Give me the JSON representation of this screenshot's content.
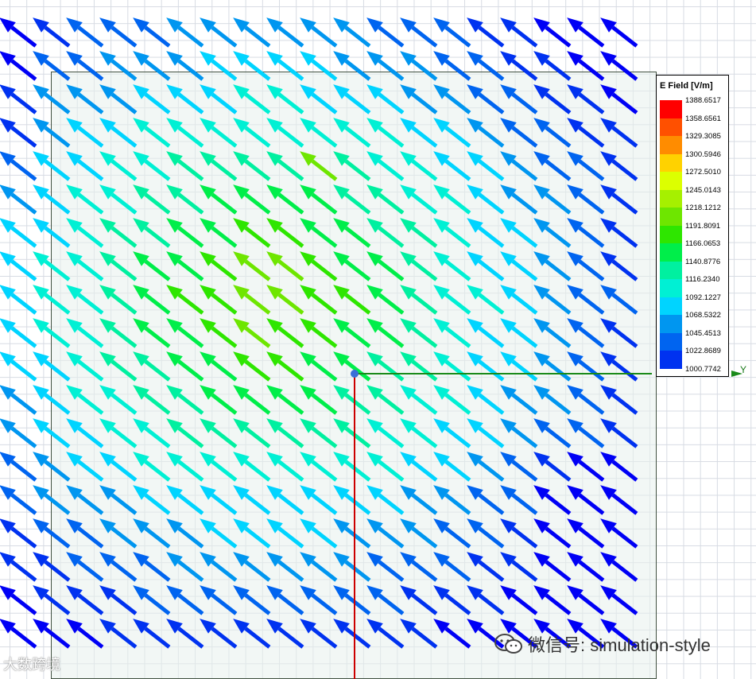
{
  "legend": {
    "title": "E Field [V/m]",
    "labels": [
      "1388.6517",
      "1358.6561",
      "1329.3085",
      "1300.5946",
      "1272.5010",
      "1245.0143",
      "1218.1212",
      "1191.8091",
      "1166.0653",
      "1140.8776",
      "1116.2340",
      "1092.1227",
      "1068.5322",
      "1045.4513",
      "1022.8689",
      "1000.7742"
    ],
    "colors": [
      "#ff0000",
      "#ff5000",
      "#ff8c00",
      "#ffd200",
      "#dcff00",
      "#a6f000",
      "#6ee600",
      "#2ee600",
      "#00ee4a",
      "#00f0a0",
      "#00f0d4",
      "#00d4ff",
      "#0096f0",
      "#0064f0",
      "#0032f0",
      "#0000f5"
    ]
  },
  "axes": {
    "y_label": "Y",
    "x_axis_color": "#cc0000",
    "y_axis_color": "#1a8a1a",
    "origin_color": "#3a6fd8"
  },
  "field": {
    "min": 1000.7742,
    "max": 1388.6517,
    "direction": "up-left"
  },
  "watermarks": {
    "left": "大数跨境",
    "right": "微信号: simulation-style"
  }
}
